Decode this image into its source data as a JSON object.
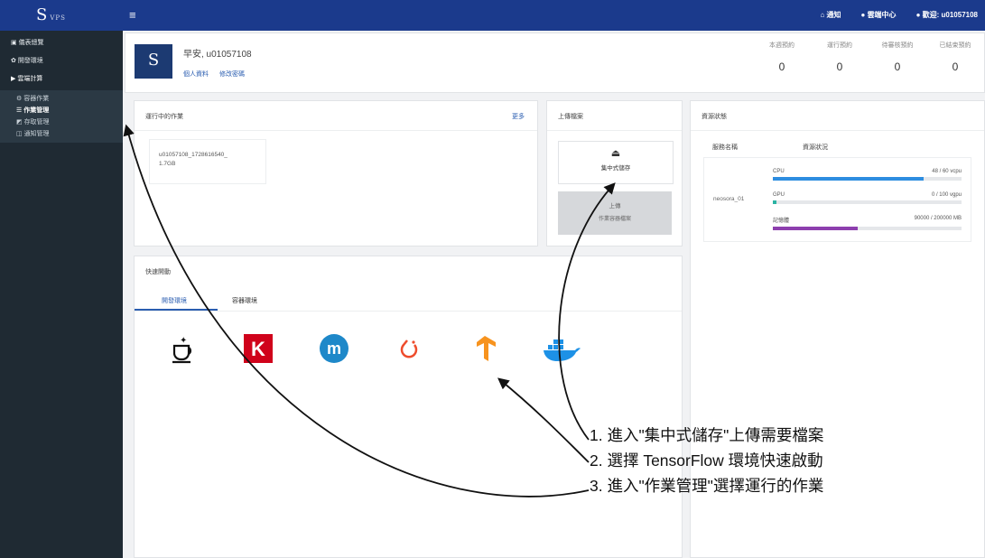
{
  "app": {
    "logo_text": "S",
    "logo_sub": "VPS",
    "menu_icon": "hamburger-icon"
  },
  "topnav": {
    "items": [
      "通知",
      "雲端中心",
      "歡迎: u01057108"
    ]
  },
  "sidebar": {
    "items": [
      "儀表總覽",
      "開發環境",
      "雲端計算"
    ],
    "subitems": [
      "容器作業",
      "作業管理",
      "存取管理",
      "通知管理"
    ]
  },
  "user": {
    "greeting": "早安, u01057108",
    "links": [
      "個人資料",
      "修改密碼"
    ],
    "stats": [
      {
        "label": "本週預約",
        "value": "0"
      },
      {
        "label": "運行預約",
        "value": "0"
      },
      {
        "label": "待審核預約",
        "value": "0"
      },
      {
        "label": "已結束預約",
        "value": "0"
      }
    ]
  },
  "running_jobs": {
    "title": "運行中的作業",
    "view_all": "更多",
    "jobs": [
      {
        "name": "u01057108_1728616540_",
        "status": "1.7GB"
      }
    ]
  },
  "upload": {
    "title": "上傳檔案",
    "store_button": "集中式儲存",
    "upload_button": "上傳",
    "upload_sub": "作業容器檔案"
  },
  "resource": {
    "title": "資源狀態",
    "col_name": "服務名稱",
    "col_usage": "資源狀況",
    "row_name": "neosora_01",
    "meters": [
      {
        "label": "CPU",
        "text": "48 / 60 vcpu",
        "ratio": 0.8,
        "color": "#2d8de0"
      },
      {
        "label": "GPU",
        "text": "0 / 100 vgpu",
        "ratio": 0.02,
        "color": "#2bb3a3"
      },
      {
        "label": "記憶體",
        "text": "90000 / 200000 MB",
        "ratio": 0.45,
        "color": "#8d3fae"
      }
    ]
  },
  "quick": {
    "title": "快速開動",
    "tabs": [
      "開發環境",
      "容器環境"
    ],
    "envs": [
      "jupyter",
      "keras",
      "mxnet",
      "pytorch",
      "tensorflow",
      "docker"
    ]
  },
  "annotations": [
    "1. 進入\"集中式儲存\"上傳需要檔案",
    "2. 選擇 TensorFlow 環境快速啟動",
    "3. 進入\"作業管理\"選擇運行的作業"
  ]
}
